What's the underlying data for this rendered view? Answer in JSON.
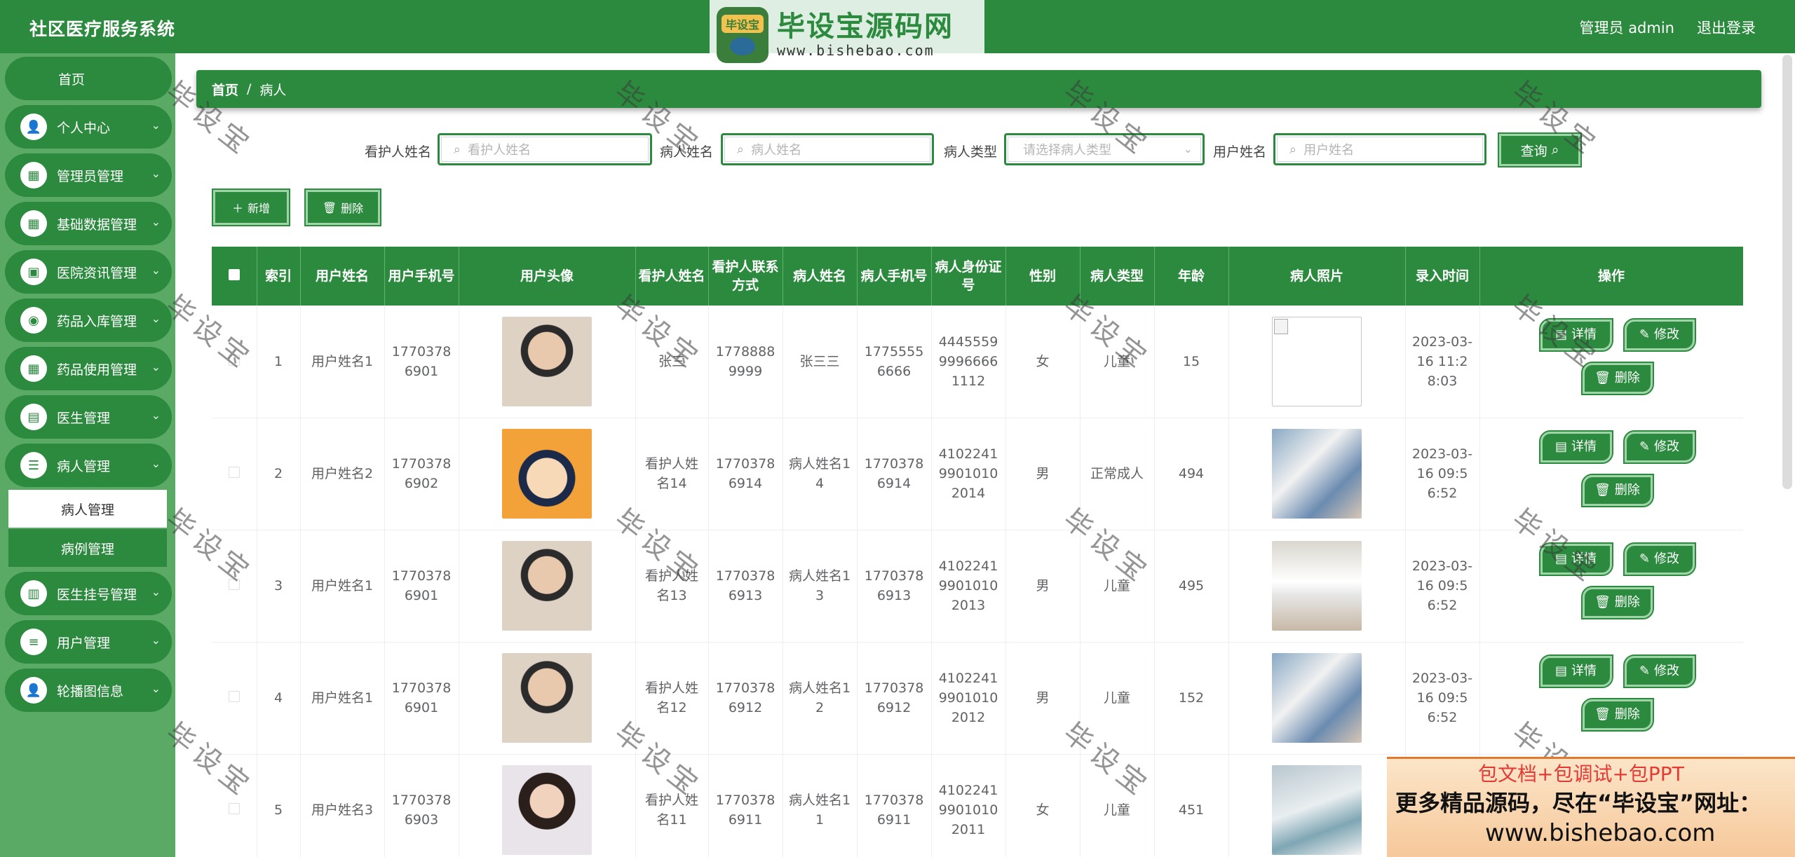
{
  "header": {
    "app_title": "社区医疗服务系统",
    "admin_label": "管理员 admin",
    "logout_label": "退出登录"
  },
  "logo": {
    "badge_text": "毕设宝",
    "main_text": "毕设宝源码网",
    "url": "www.bishebao.com"
  },
  "sidebar": {
    "items": [
      {
        "label": "首页",
        "icon": "home-icon"
      },
      {
        "label": "个人中心",
        "icon": "user-icon"
      },
      {
        "label": "管理员管理",
        "icon": "grid-icon"
      },
      {
        "label": "基础数据管理",
        "icon": "grid-icon"
      },
      {
        "label": "医院资讯管理",
        "icon": "wallet-icon"
      },
      {
        "label": "药品入库管理",
        "icon": "location-icon"
      },
      {
        "label": "药品使用管理",
        "icon": "grid-icon"
      },
      {
        "label": "医生管理",
        "icon": "briefcase-icon"
      },
      {
        "label": "病人管理",
        "icon": "sliders-icon"
      },
      {
        "label": "医生挂号管理",
        "icon": "clipboard-icon"
      },
      {
        "label": "用户管理",
        "icon": "list-icon"
      },
      {
        "label": "轮播图信息",
        "icon": "user-icon"
      }
    ],
    "sub_items": [
      {
        "label": "病人管理",
        "active": true
      },
      {
        "label": "病例管理",
        "active": false
      }
    ]
  },
  "breadcrumb": {
    "home": "首页",
    "separator": "/",
    "current": "病人"
  },
  "search": {
    "caregiver_label": "看护人姓名",
    "caregiver_placeholder": "看护人姓名",
    "patient_label": "病人姓名",
    "patient_placeholder": "病人姓名",
    "type_label": "病人类型",
    "type_placeholder": "请选择病人类型",
    "user_label": "用户姓名",
    "user_placeholder": "用户姓名",
    "query_label": "查询"
  },
  "actions": {
    "add_label": "新增",
    "delete_label": "删除"
  },
  "table": {
    "columns": [
      "索引",
      "用户姓名",
      "用户手机号",
      "用户头像",
      "看护人姓名",
      "看护人联系方式",
      "病人姓名",
      "病人手机号",
      "病人身份证号",
      "性别",
      "病人类型",
      "年龄",
      "病人照片",
      "录入时间",
      "操作"
    ],
    "buttons": {
      "detail": "详情",
      "edit": "修改",
      "delete": "删除"
    },
    "rows": [
      {
        "index": "1",
        "user_name": "用户姓名1",
        "user_phone": "17703786901",
        "avatar": "young-man-photo",
        "caregiver": "张三",
        "caregiver_contact": "17788889999",
        "patient_name": "张三三",
        "patient_phone": "17755556666",
        "id_number": "444555999966661112",
        "gender": "女",
        "type": "儿童",
        "age": "15",
        "photo": "broken-image",
        "created": "2023-03-16 11:28:03"
      },
      {
        "index": "2",
        "user_name": "用户姓名2",
        "user_phone": "17703786902",
        "avatar": "cartoon-detective",
        "caregiver": "看护人姓名14",
        "caregiver_contact": "17703786914",
        "patient_name": "病人姓名14",
        "patient_phone": "17703786914",
        "id_number": "410224199010102014",
        "gender": "男",
        "type": "正常成人",
        "age": "494",
        "photo": "medical-photo",
        "created": "2023-03-16 09:56:52"
      },
      {
        "index": "3",
        "user_name": "用户姓名1",
        "user_phone": "17703786901",
        "avatar": "young-man-photo",
        "caregiver": "看护人姓名13",
        "caregiver_contact": "17703786913",
        "patient_name": "病人姓名13",
        "patient_phone": "17703786913",
        "id_number": "410224199010102013",
        "gender": "男",
        "type": "儿童",
        "age": "495",
        "photo": "nurses-photo",
        "created": "2023-03-16 09:56:52"
      },
      {
        "index": "4",
        "user_name": "用户姓名1",
        "user_phone": "17703786901",
        "avatar": "young-man-photo",
        "caregiver": "看护人姓名12",
        "caregiver_contact": "17703786912",
        "patient_name": "病人姓名12",
        "patient_phone": "17703786912",
        "id_number": "410224199010102012",
        "gender": "男",
        "type": "儿童",
        "age": "152",
        "photo": "medical-photo",
        "created": "2023-03-16 09:56:52"
      },
      {
        "index": "5",
        "user_name": "用户姓名3",
        "user_phone": "17703786903",
        "avatar": "woman-photo",
        "caregiver": "看护人姓名11",
        "caregiver_contact": "17703786911",
        "patient_name": "病人姓名11",
        "patient_phone": "17703786911",
        "id_number": "410224199010102011",
        "gender": "女",
        "type": "儿童",
        "age": "451",
        "photo": "ward-photo",
        "created": ""
      }
    ]
  },
  "watermark": "毕设宝",
  "ad": {
    "line1": "包文档+包调试+包PPT",
    "line2": "更多精品源码，尽在“毕设宝”网址：",
    "line3": "www.bishebao.com"
  },
  "colors": {
    "primary": "#2b8a3e",
    "sidebar_bg": "#5aaa66",
    "button_border": "#9fd3a8"
  }
}
